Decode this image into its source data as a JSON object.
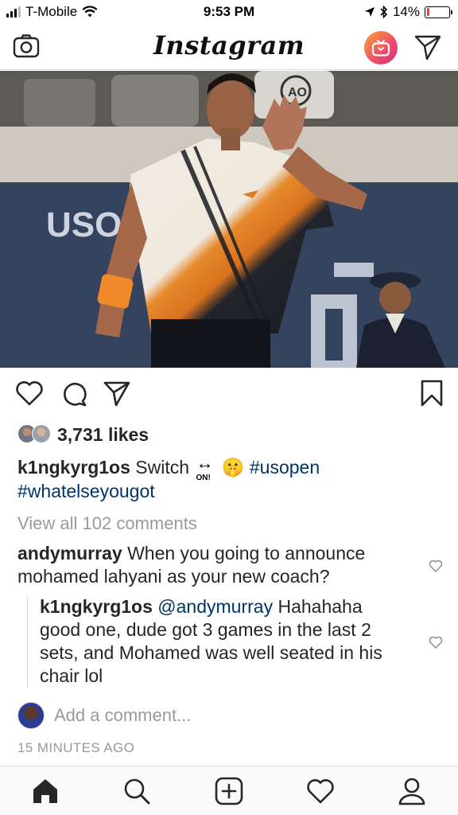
{
  "status_bar": {
    "carrier": "T-Mobile",
    "time": "9:53 PM",
    "battery": "14%",
    "battery_level": 0.14,
    "battery_color": "#ff3b30"
  },
  "header": {
    "logo": "Instagram",
    "icons": [
      "camera-icon",
      "igtv-icon",
      "direct-message-icon"
    ]
  },
  "post": {
    "likes": "3,731 likes",
    "caption": {
      "username": "k1ngkyrg1os",
      "text": "Switch",
      "emoji_1": "↔",
      "emoji_1_label": "ON!",
      "emoji_2": "🤫",
      "hashtag_1": "#usopen",
      "hashtag_2": "#whatelseyougot"
    },
    "view_all_comments": "View all 102 comments",
    "comments": [
      {
        "username": "andymurray",
        "text": "When you going to announce mohamed lahyani as your new coach?"
      }
    ],
    "reply": {
      "username": "k1ngkyrg1os",
      "mention": "@andymurray",
      "text": "Hahahaha good one, dude got 3 games in the last 2 sets, and Mohamed was well seated in his chair lol"
    },
    "add_comment_placeholder": "Add a comment...",
    "timestamp": "15 MINUTES AGO",
    "photo_banner_text": "USOPE",
    "photo_badge_text": "AO"
  },
  "bottom_nav": [
    "home-icon",
    "search-icon",
    "new-post-icon",
    "activity-icon",
    "profile-icon"
  ],
  "colors": {
    "hashtag": "#003569",
    "muted": "#999999",
    "border": "#dbdbdb",
    "igtv_gradient": [
      "#f9a43a",
      "#ee4b6a",
      "#d62e7c"
    ]
  }
}
